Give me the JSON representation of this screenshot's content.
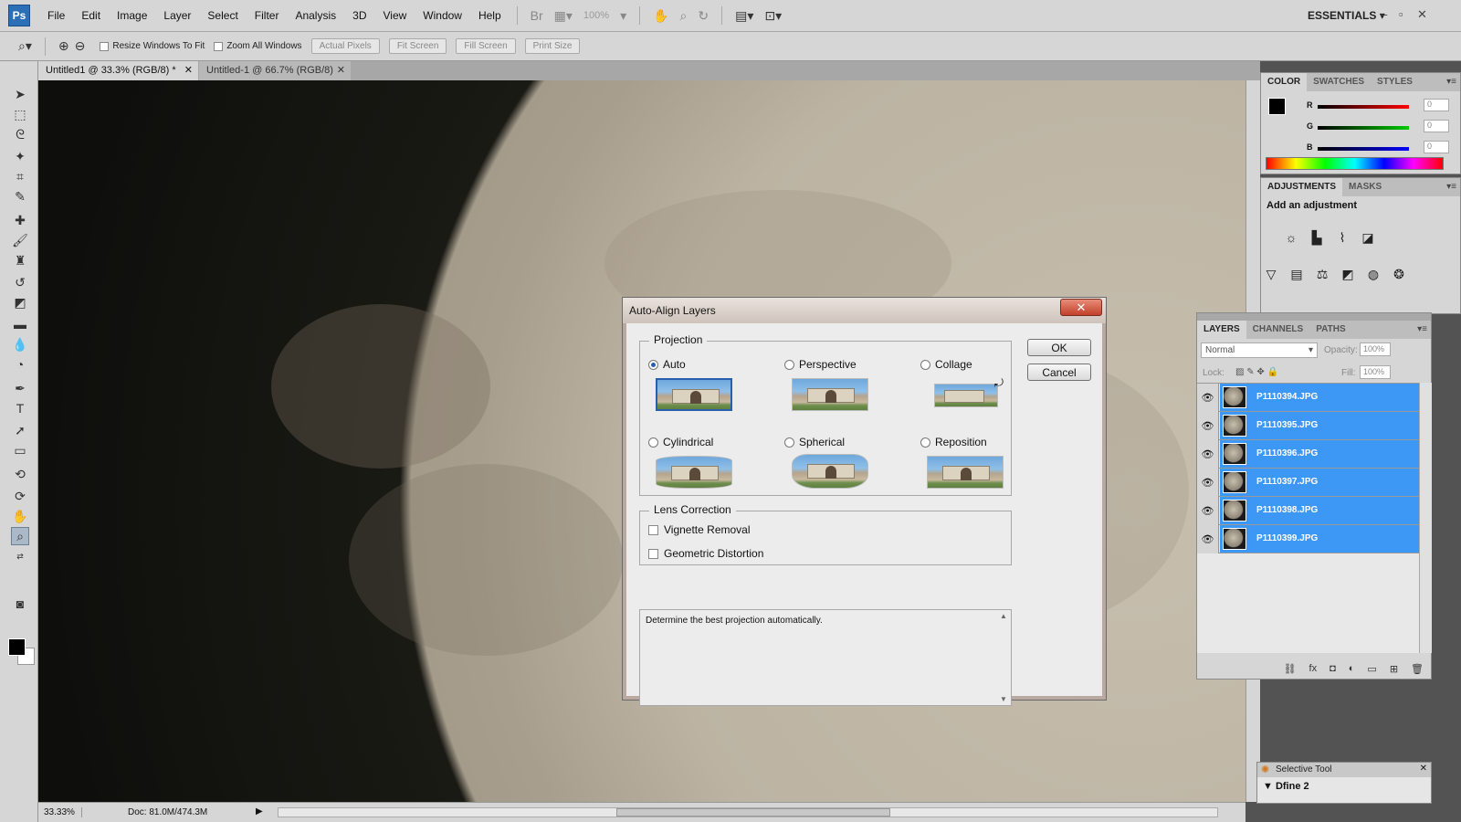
{
  "menubar": {
    "logo": "Ps",
    "items": [
      "File",
      "Edit",
      "Image",
      "Layer",
      "Select",
      "Filter",
      "Analysis",
      "3D",
      "View",
      "Window",
      "Help"
    ],
    "bridge_label": "Br",
    "zoom_level": "100%",
    "workspace": "ESSENTIALS"
  },
  "options": {
    "resize_windows_to_fit": "Resize Windows To Fit",
    "zoom_all_windows": "Zoom All Windows",
    "actual_pixels": "Actual Pixels",
    "fit_screen": "Fit Screen",
    "fill_screen": "Fill Screen",
    "print_size": "Print Size"
  },
  "tabs": [
    {
      "label": "Untitled1 @ 33.3% (RGB/8) *"
    },
    {
      "label": "Untitled-1 @ 66.7% (RGB/8)"
    }
  ],
  "status": {
    "zoom": "33.33%",
    "doc": "Doc: 81.0M/474.3M"
  },
  "color_panel": {
    "tabs": [
      "COLOR",
      "SWATCHES",
      "STYLES"
    ],
    "channels": [
      {
        "label": "R",
        "value": "0",
        "color": "#e00000"
      },
      {
        "label": "G",
        "value": "0",
        "color": "#00b000"
      },
      {
        "label": "B",
        "value": "0",
        "color": "#0000e0"
      }
    ]
  },
  "adjustments_panel": {
    "tabs": [
      "ADJUSTMENTS",
      "MASKS"
    ],
    "title": "Add an adjustment"
  },
  "layers_panel": {
    "tabs": [
      "LAYERS",
      "CHANNELS",
      "PATHS"
    ],
    "blend_mode": "Normal",
    "opacity_label": "Opacity:",
    "opacity_value": "100%",
    "lock_label": "Lock:",
    "fill_label": "Fill:",
    "fill_value": "100%",
    "layers": [
      {
        "name": "P1110394.JPG"
      },
      {
        "name": "P1110395.JPG"
      },
      {
        "name": "P1110396.JPG"
      },
      {
        "name": "P1110397.JPG"
      },
      {
        "name": "P1110398.JPG"
      },
      {
        "name": "P1110399.JPG"
      }
    ],
    "selected_color": "#3d97f5"
  },
  "selective_tool": {
    "title": "Selective Tool",
    "item": "Dfine 2"
  },
  "dialog": {
    "title": "Auto-Align Layers",
    "close_glyph": "✕",
    "projection_label": "Projection",
    "projections": [
      {
        "label": "Auto"
      },
      {
        "label": "Perspective"
      },
      {
        "label": "Collage"
      },
      {
        "label": "Cylindrical"
      },
      {
        "label": "Spherical"
      },
      {
        "label": "Reposition"
      }
    ],
    "lens_correction_label": "Lens Correction",
    "vignette_removal": "Vignette Removal",
    "geometric_distortion": "Geometric Distortion",
    "ok": "OK",
    "cancel": "Cancel",
    "description": "Determine the best projection automatically."
  }
}
